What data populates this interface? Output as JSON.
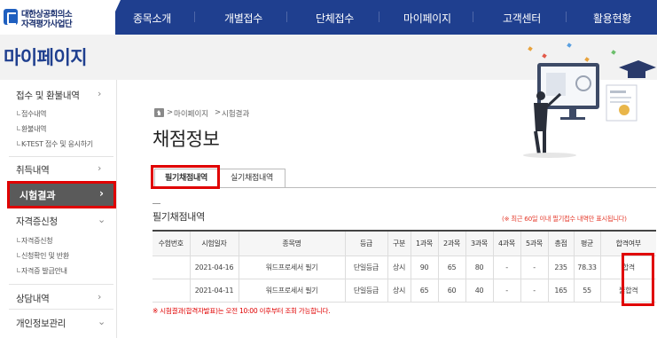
{
  "header": {
    "logo_line1": "대한상공회의소",
    "logo_line2": "자격평가사업단",
    "nav": [
      "종목소개",
      "개별접수",
      "단체접수",
      "마이페이지",
      "고객센터",
      "활용현황"
    ]
  },
  "banner": {
    "title": "마이페이지"
  },
  "sidebar": {
    "items": [
      {
        "label": "접수 및 환불내역",
        "subitems": [
          "접수내역",
          "환불내역",
          "K-TEST 접수 및 응시하기"
        ]
      },
      {
        "label": "취득내역",
        "subitems": []
      },
      {
        "label": "시험결과",
        "active": true,
        "subitems": []
      },
      {
        "label": "자격증신청",
        "subitems": [
          "자격증신청",
          "신청확인 및 반환",
          "자격증 발급안내"
        ]
      },
      {
        "label": "상담내역",
        "subitems": []
      },
      {
        "label": "개인정보관리",
        "subitems": []
      }
    ]
  },
  "breadcrumb": [
    "마이페이지",
    "시험결과"
  ],
  "page_title": "채점정보",
  "tabs": [
    {
      "label": "필기채점내역",
      "active": true
    },
    {
      "label": "실기채점내역",
      "active": false
    }
  ],
  "section": {
    "title": "필기채점내역",
    "notice": "(※ 최근 60일 이내 필기접수 내역만 표시됩니다)"
  },
  "table": {
    "headers": [
      "수험번호",
      "시험일자",
      "종목명",
      "등급",
      "구분",
      "1과목",
      "2과목",
      "3과목",
      "4과목",
      "5과목",
      "총점",
      "평균",
      "합격여부"
    ],
    "rows": [
      [
        "",
        "2021-04-16",
        "워드프로세서 필기",
        "단일등급",
        "상시",
        "90",
        "65",
        "80",
        "-",
        "-",
        "235",
        "78.33",
        "합격"
      ],
      [
        "",
        "2021-04-11",
        "워드프로세서 필기",
        "단일등급",
        "상시",
        "65",
        "60",
        "40",
        "-",
        "-",
        "165",
        "55",
        "불합격"
      ]
    ]
  },
  "bottom_notice": "※ 시험결과(합격자발표)는 오전 10:00 이후부터 조회 가능합니다.",
  "colors": {
    "nav_bg": "#1f3f8f",
    "highlight": "#e00000",
    "active_side": "#5a5a5a"
  }
}
